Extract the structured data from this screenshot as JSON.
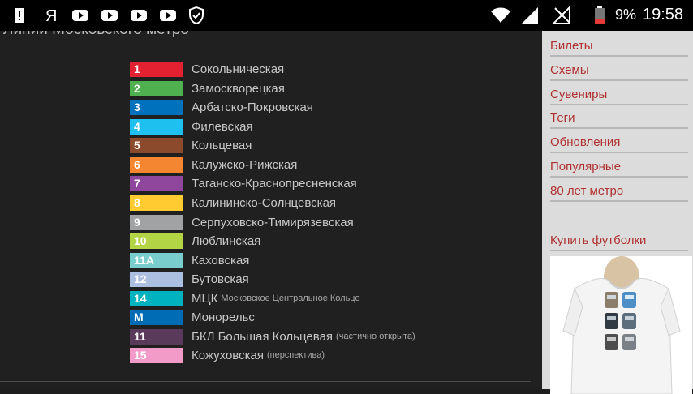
{
  "status": {
    "battery": "9%",
    "time": "19:58"
  },
  "page": {
    "title": "Линии Московского метро"
  },
  "lines": [
    {
      "num": "1",
      "name": "Сокольническая",
      "note": "",
      "color": "#e42131"
    },
    {
      "num": "2",
      "name": "Замоскворецкая",
      "note": "",
      "color": "#4fb04f"
    },
    {
      "num": "3",
      "name": "Арбатско-Покровская",
      "note": "",
      "color": "#0071bc"
    },
    {
      "num": "4",
      "name": "Филевская",
      "note": "",
      "color": "#1ec0ef"
    },
    {
      "num": "5",
      "name": "Кольцевая",
      "note": "",
      "color": "#8b4a2b"
    },
    {
      "num": "6",
      "name": "Калужско-Рижская",
      "note": "",
      "color": "#f58631"
    },
    {
      "num": "7",
      "name": "Таганско-Краснопресненская",
      "note": "",
      "color": "#8e479c"
    },
    {
      "num": "8",
      "name": "Калининско-Солнцевская",
      "note": "",
      "color": "#ffcb31"
    },
    {
      "num": "9",
      "name": "Серпуховско-Тимирязевская",
      "note": "",
      "color": "#a1a2a3"
    },
    {
      "num": "10",
      "name": "Люблинская",
      "note": "",
      "color": "#b3d445"
    },
    {
      "num": "11А",
      "name": "Каховская",
      "note": "",
      "color": "#79cdcd"
    },
    {
      "num": "12",
      "name": "Бутовская",
      "note": "",
      "color": "#acbfe1"
    },
    {
      "num": "14",
      "name": "МЦК",
      "note": "Московское Центральное Кольцо",
      "color": "#00b2bf"
    },
    {
      "num": "М",
      "name": "Монорельс",
      "note": "",
      "color": "#006cb6"
    },
    {
      "num": "11",
      "name": "БКЛ Большая Кольцевая",
      "note": "(частично открыта)",
      "color": "#5a3a5a"
    },
    {
      "num": "15",
      "name": "Кожуховская",
      "note": "(перспектива)",
      "color": "#f29ac8"
    }
  ],
  "sidebar": {
    "items": [
      "Билеты",
      "Схемы",
      "Сувениры",
      "Теги",
      "Обновления",
      "Популярные",
      "80 лет метро"
    ],
    "shop_link": "Купить футболки"
  },
  "colors": {
    "link": "#b03030",
    "sidebar_bg": "#dcdcdc",
    "main_bg": "#202020"
  }
}
